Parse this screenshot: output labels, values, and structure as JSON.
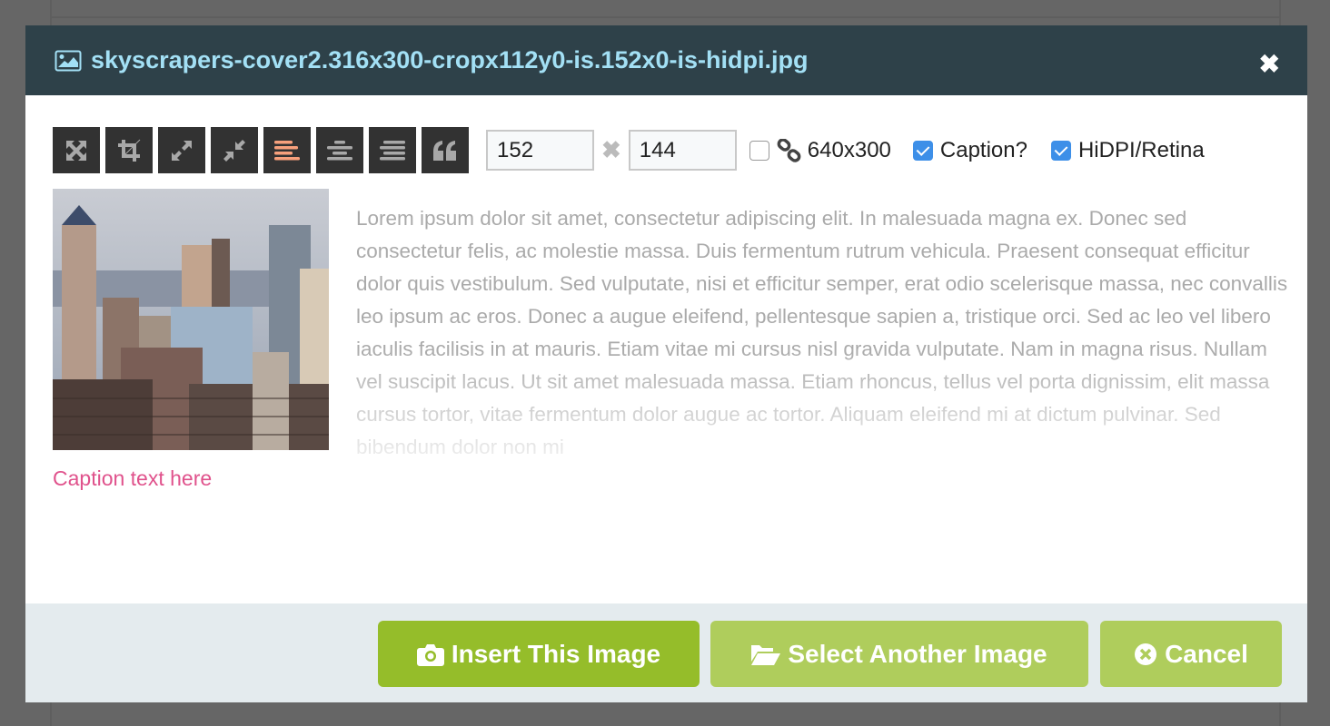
{
  "modal": {
    "title": "skyscrapers-cover2.316x300-cropx112y0-is.152x0-is-hidpi.jpg",
    "title_icon": "image-icon",
    "close_icon": "close-icon"
  },
  "toolbar": {
    "tools": [
      {
        "name": "fullsize",
        "icon": "expand-arrows-icon"
      },
      {
        "name": "crop",
        "icon": "crop-icon"
      },
      {
        "name": "enlarge",
        "icon": "expand-icon"
      },
      {
        "name": "shrink",
        "icon": "compress-icon"
      },
      {
        "name": "align-left",
        "icon": "align-left-icon",
        "active": true
      },
      {
        "name": "align-center",
        "icon": "align-center-icon"
      },
      {
        "name": "align-right",
        "icon": "align-right-icon"
      },
      {
        "name": "quote",
        "icon": "quote-icon"
      }
    ],
    "width_value": "152",
    "height_value": "144",
    "original_size_label": "640x300",
    "lock_ratio_checked": false,
    "caption_label": "Caption?",
    "caption_checked": true,
    "hidpi_label": "HiDPI/Retina",
    "hidpi_checked": true
  },
  "preview": {
    "caption": "Caption text here",
    "lorem": "Lorem ipsum dolor sit amet, consectetur adipiscing elit. In malesuada magna ex. Donec sed consectetur felis, ac molestie massa. Duis fermentum rutrum vehicula. Praesent consequat efficitur dolor quis vestibulum. Sed vulputate, nisi et efficitur semper, erat odio scelerisque massa, nec convallis leo ipsum ac eros. Donec a augue eleifend, pellentesque sapien a, tristique orci. Sed ac leo vel libero iaculis facilisis in at mauris. Etiam vitae mi cursus nisl gravida vulputate. Nam in magna risus. Nullam vel suscipit lacus. Ut sit amet malesuada massa. Etiam rhoncus, tellus vel porta dignissim, elit massa cursus tortor, vitae fermentum dolor augue ac tortor. Aliquam eleifend mi at dictum pulvinar. Sed bibendum dolor non mi"
  },
  "footer": {
    "insert_label": "Insert This Image",
    "select_label": "Select Another Image",
    "cancel_label": "Cancel"
  },
  "colors": {
    "header_bg": "#2e4149",
    "title": "#a3e0f5",
    "active_tool": "#f7a07c",
    "primary_button": "#95bd2a",
    "secondary_button": "#afcd5c",
    "caption": "#e0528c"
  }
}
